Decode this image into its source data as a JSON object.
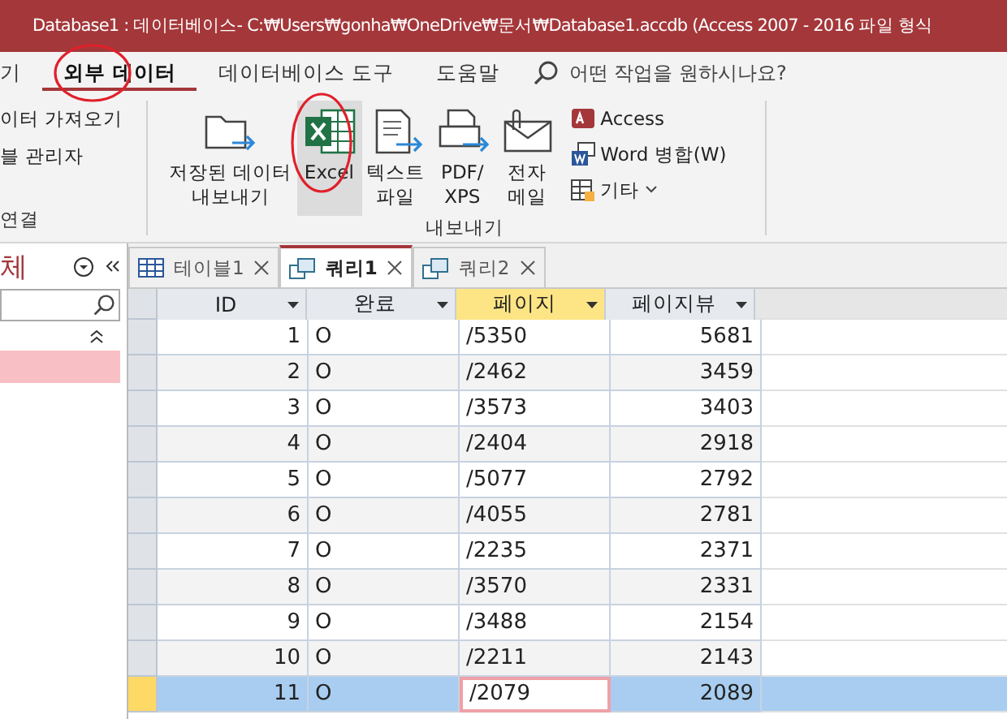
{
  "window": {
    "title": "Database1 : 데이터베이스- C:₩Users₩gonha₩OneDrive₩문서₩Database1.accdb (Access 2007 - 2016 파일 형식"
  },
  "ribbon_tabs": [
    {
      "label": "기",
      "selected": false
    },
    {
      "label": "외부 데이터",
      "selected": true
    },
    {
      "label": "데이터베이스 도구",
      "selected": false
    },
    {
      "label": "도움말",
      "selected": false
    }
  ],
  "tell_me": {
    "placeholder": "어떤 작업을 원하시나요?"
  },
  "import_group": {
    "items": [
      "이터 가져오기",
      "블 관리자"
    ],
    "label": "연결"
  },
  "export_group": {
    "label": "내보내기",
    "buttons": [
      {
        "kind": "saved",
        "label": "저장된 데이터\n내보내기",
        "selected": false
      },
      {
        "kind": "excel",
        "label": "Excel",
        "selected": true
      },
      {
        "kind": "text",
        "label": "텍스트\n파일",
        "selected": false
      },
      {
        "kind": "pdf",
        "label": "PDF/\nXPS",
        "selected": false
      },
      {
        "kind": "email",
        "label": "전자\n메일",
        "selected": false
      }
    ],
    "small_buttons": [
      {
        "kind": "access",
        "label": "Access"
      },
      {
        "kind": "word",
        "label": "Word 병합(W)"
      },
      {
        "kind": "more",
        "label": "기타"
      }
    ]
  },
  "nav_pane": {
    "title": "체"
  },
  "doc_tabs": [
    {
      "kind": "table",
      "label": "테이블1",
      "selected": false
    },
    {
      "kind": "query",
      "label": "쿼리1",
      "selected": true
    },
    {
      "kind": "query",
      "label": "쿼리2",
      "selected": false
    }
  ],
  "table": {
    "columns": [
      {
        "label": "ID",
        "selected": false
      },
      {
        "label": "완료",
        "selected": false
      },
      {
        "label": "페이지",
        "selected": true
      },
      {
        "label": "페이지뷰",
        "selected": false
      }
    ],
    "rows": [
      {
        "cells": [
          "1",
          "O",
          "/5350",
          "5681"
        ],
        "selected": false
      },
      {
        "cells": [
          "2",
          "O",
          "/2462",
          "3459"
        ],
        "selected": false
      },
      {
        "cells": [
          "3",
          "O",
          "/3573",
          "3403"
        ],
        "selected": false
      },
      {
        "cells": [
          "4",
          "O",
          "/2404",
          "2918"
        ],
        "selected": false
      },
      {
        "cells": [
          "5",
          "O",
          "/5077",
          "2792"
        ],
        "selected": false
      },
      {
        "cells": [
          "6",
          "O",
          "/4055",
          "2781"
        ],
        "selected": false
      },
      {
        "cells": [
          "7",
          "O",
          "/2235",
          "2371"
        ],
        "selected": false
      },
      {
        "cells": [
          "8",
          "O",
          "/3570",
          "2331"
        ],
        "selected": false
      },
      {
        "cells": [
          "9",
          "O",
          "/3488",
          "2154"
        ],
        "selected": false
      },
      {
        "cells": [
          "10",
          "O",
          "/2211",
          "2143"
        ],
        "selected": false
      },
      {
        "cells": [
          "11",
          "O",
          "/2079",
          "2089"
        ],
        "selected": true
      }
    ]
  }
}
